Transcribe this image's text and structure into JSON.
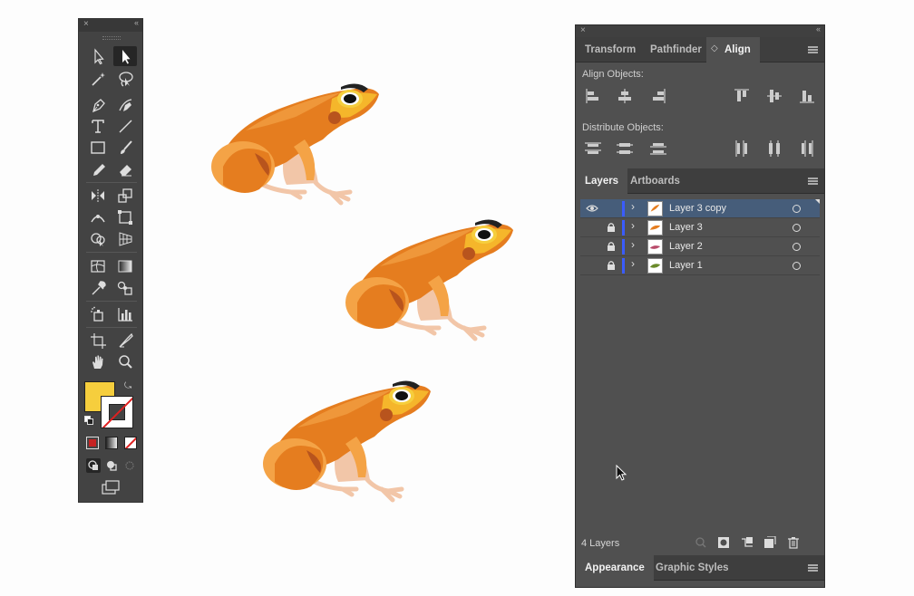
{
  "tools_panel": {
    "close": "×",
    "collapse": "‹‹"
  },
  "right_panel": {
    "close": "×",
    "collapse": "‹‹",
    "top_tabs": [
      "Transform",
      "Pathfinder",
      "Align"
    ],
    "active_top_tab": "Align",
    "align_objects_label": "Align Objects:",
    "distribute_objects_label": "Distribute Objects:",
    "layer_tabs": [
      "Layers",
      "Artboards"
    ],
    "layers": [
      {
        "name": "Layer 3 copy",
        "visible": true,
        "locked": false,
        "selected": true
      },
      {
        "name": "Layer 3",
        "visible": false,
        "locked": true,
        "selected": false
      },
      {
        "name": "Layer 2",
        "visible": false,
        "locked": true,
        "selected": false
      },
      {
        "name": "Layer 1",
        "visible": false,
        "locked": true,
        "selected": false
      }
    ],
    "layer_count": "4 Layers",
    "bottom_tabs": [
      "Appearance",
      "Graphic Styles"
    ]
  },
  "colors": {
    "fill": "#f6ce3d",
    "layer_color": "#3a5cff",
    "selection": "#465d7a",
    "frog_main": "#e57d1f",
    "frog_light": "#f4a346",
    "frog_belly": "#f2c6a8",
    "frog_dark": "#b8541d"
  },
  "icons": {
    "cursor": "arrow-cursor-icon"
  }
}
